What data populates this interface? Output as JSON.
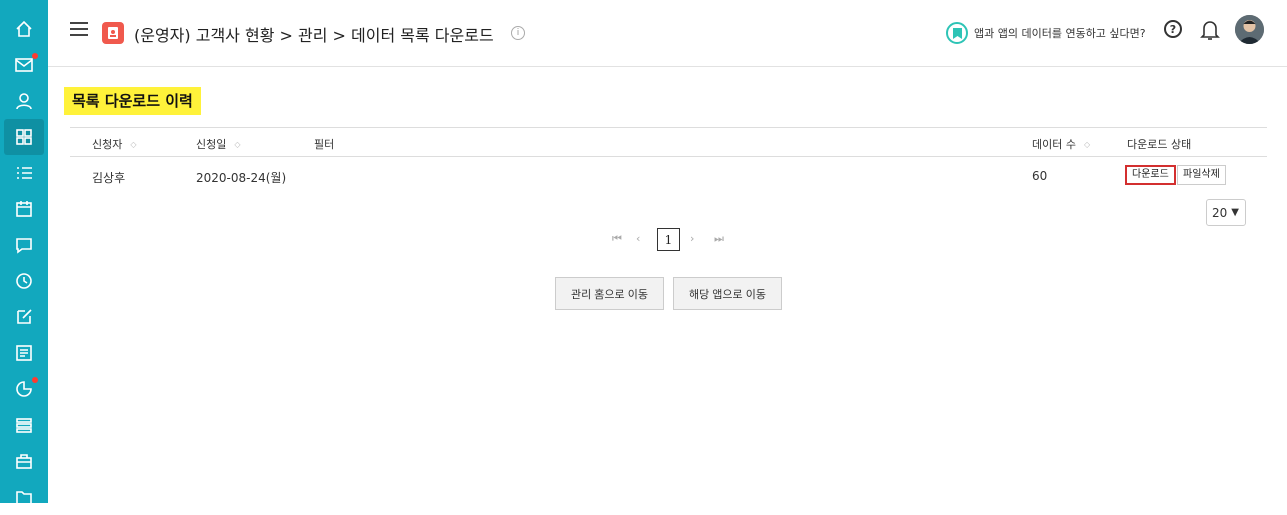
{
  "header": {
    "breadcrumb": "(운영자) 고객사 현황 > 관리 > 데이터 목록 다운로드",
    "info_glyph": "i",
    "promo_text": "앱과 앱의 데이터를 연동하고 싶다면?",
    "help_glyph": "?"
  },
  "section": {
    "title": "목록 다운로드 이력"
  },
  "table": {
    "headers": {
      "applicant": "신청자",
      "date": "신청일",
      "filter": "필터",
      "data_count": "데이터 수",
      "status": "다운로드 상태"
    },
    "rows": [
      {
        "applicant": "김상후",
        "date": "2020-08-24(월)",
        "filter": "",
        "data_count": "60",
        "download_label": "다운로드",
        "delete_label": "파일삭제"
      }
    ]
  },
  "pagination": {
    "current_page": "1",
    "page_size": "20"
  },
  "actions": {
    "admin_home": "관리 홈으로 이동",
    "app": "해당 앱으로 이동"
  },
  "colors": {
    "sidebar": "#12a8be",
    "highlight": "#fff23a",
    "notify_dot": "#ff3b30",
    "app_icon": "#f0594d",
    "download_border": "#d32f2f"
  },
  "icons": [
    "home-icon",
    "mail-icon",
    "user-icon",
    "grid-icon",
    "list-icon",
    "calendar-icon",
    "chat-icon",
    "clock-icon",
    "edit-icon",
    "report-icon",
    "chart-icon",
    "stack-icon",
    "briefcase-icon",
    "folder-icon"
  ]
}
